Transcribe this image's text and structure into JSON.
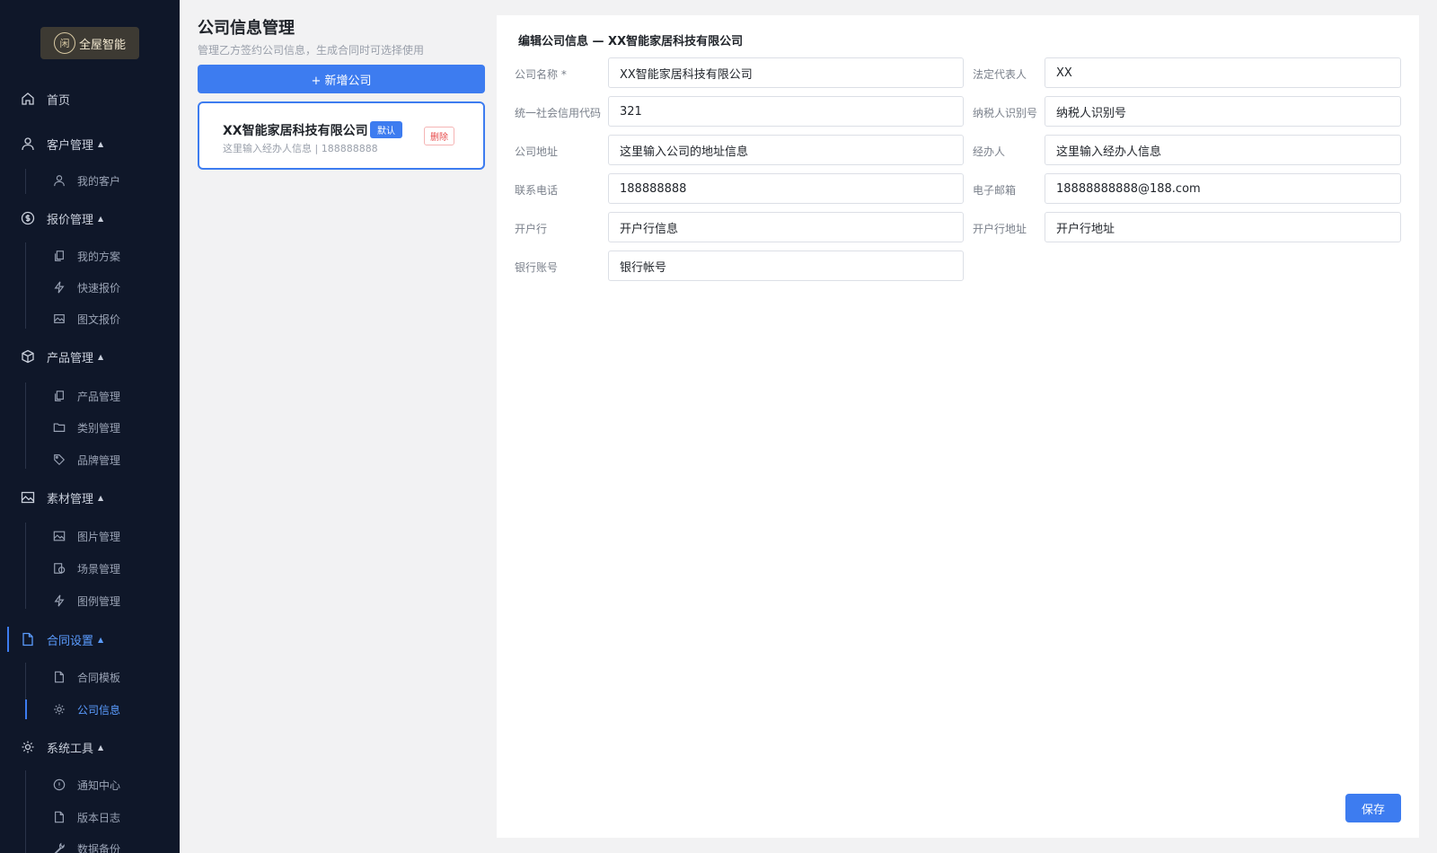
{
  "brand": {
    "mark": "闲",
    "name": "全屋智能"
  },
  "nav": {
    "home": "首页",
    "customer": "客户管理",
    "my_customers": "我的客户",
    "quote": "报价管理",
    "my_plans": "我的方案",
    "quick_quote": "快速报价",
    "image_quote": "图文报价",
    "product": "产品管理",
    "product_mgmt": "产品管理",
    "category_mgmt": "类别管理",
    "brand_mgmt": "品牌管理",
    "material": "素材管理",
    "image_mgmt": "图片管理",
    "scene_mgmt": "场景管理",
    "legend_mgmt": "图例管理",
    "contract": "合同设置",
    "contract_template": "合同模板",
    "company_info": "公司信息",
    "tools": "系统工具",
    "notice_center": "通知中心",
    "changelog": "版本日志",
    "backup": "数据备份"
  },
  "left": {
    "title": "公司信息管理",
    "subtitle": "管理乙方签约公司信息，生成合同时可选择使用",
    "add_button": "+ 新增公司",
    "card": {
      "name": "XX智能家居科技有限公司",
      "tag": "默认",
      "info": "这里输入经办人信息 | 188888888",
      "delete": "删除"
    }
  },
  "form": {
    "title": "编辑公司信息 — XX智能家居科技有限公司",
    "labels": {
      "company_name": "公司名称 *",
      "legal_rep": "法定代表人",
      "credit_code": "统一社会信用代码",
      "taxpayer_id": "纳税人识别号",
      "address": "公司地址",
      "handler": "经办人",
      "phone": "联系电话",
      "email": "电子邮箱",
      "bank": "开户行",
      "bank_address": "开户行地址",
      "account": "银行账号"
    },
    "values": {
      "company_name": "XX智能家居科技有限公司",
      "legal_rep": "XX",
      "credit_code": "321",
      "taxpayer_id": "纳税人识别号",
      "address": "这里输入公司的地址信息",
      "handler": "这里输入经办人信息",
      "phone": "188888888",
      "email": "18888888888@188.com",
      "bank": "开户行信息",
      "bank_address": "开户行地址",
      "account": "银行帐号"
    },
    "save": "保存"
  },
  "colors": {
    "sidebar": "#0f1729",
    "accent": "#3d7cf0",
    "danger": "#e84c4c"
  }
}
